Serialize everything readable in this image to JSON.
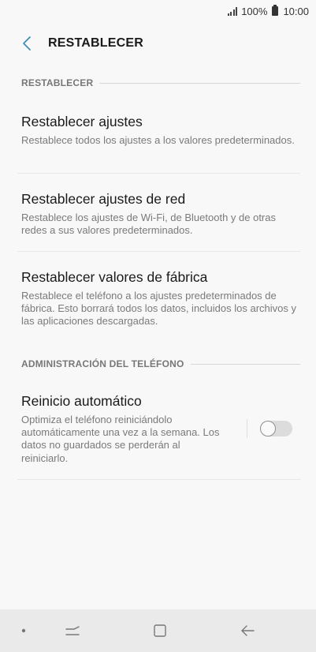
{
  "status_bar": {
    "battery": "100%",
    "time": "10:00",
    "icons": [
      "signal-icon",
      "battery-icon"
    ]
  },
  "header": {
    "title": "RESTABLECER",
    "back_icon": "back-chevron-icon"
  },
  "sections": [
    {
      "header": "RESTABLECER",
      "items": [
        {
          "title": "Restablecer ajustes",
          "subtitle": "Restablece todos los ajustes a los valores predeterminados."
        },
        {
          "title": "Restablecer ajustes de red",
          "subtitle": "Restablece los ajustes de Wi-Fi, de Bluetooth y de otras redes a sus valores predeterminados."
        },
        {
          "title": "Restablecer valores de fábrica",
          "subtitle": "Restablece el teléfono a los ajustes predeterminados de fábrica. Esto borrará todos los datos, incluidos los archivos y las aplicaciones descargadas."
        }
      ]
    },
    {
      "header": "ADMINISTRACIÓN DEL TELÉFONO",
      "items": [
        {
          "title": "Reinicio automático",
          "subtitle": "Optimiza el teléfono reiniciándolo automáticamente una vez a la semana. Los datos no guardados se perderán al reiniciarlo.",
          "toggle": false
        }
      ]
    }
  ],
  "nav_bar": {
    "buttons": [
      "dot-icon",
      "recents-icon",
      "home-icon",
      "back-arrow-icon"
    ]
  },
  "colors": {
    "background": "#f8f8f8",
    "back_chevron": "#3f8db7",
    "navbar": "#eaeaea"
  }
}
